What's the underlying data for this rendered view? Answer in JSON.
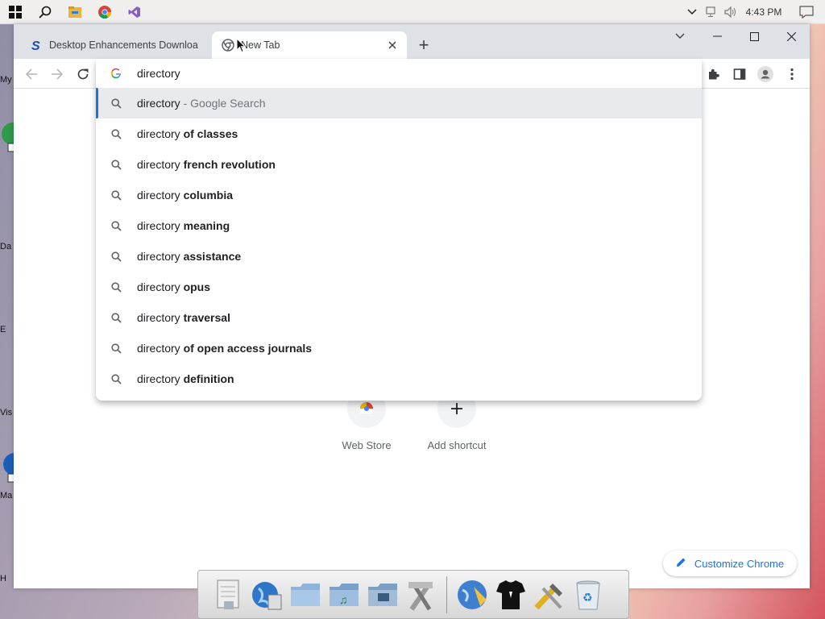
{
  "taskbar": {
    "clock": "4:43 PM",
    "icons": [
      "windows-start-icon",
      "search-icon",
      "file-explorer-icon",
      "chrome-icon",
      "visual-studio-icon"
    ]
  },
  "desktop_fragments": [
    "My",
    "Da",
    "E",
    "Vis",
    "Ma",
    "H"
  ],
  "browser": {
    "tabs": [
      {
        "title": "Desktop Enhancements Downloa",
        "favicon": "s-logo-icon",
        "active": false
      },
      {
        "title": "New Tab",
        "favicon": "chrome-icon",
        "active": true
      }
    ],
    "new_tab_symbol": "+",
    "omnibox": {
      "query": "directory",
      "suggestions": [
        {
          "prefix": "directory",
          "suffix": "",
          "hint": "Google Search",
          "selected": true
        },
        {
          "prefix": "directory",
          "suffix": "of classes",
          "hint": "",
          "selected": false
        },
        {
          "prefix": "directory",
          "suffix": "french revolution",
          "hint": "",
          "selected": false
        },
        {
          "prefix": "directory",
          "suffix": "columbia",
          "hint": "",
          "selected": false
        },
        {
          "prefix": "directory",
          "suffix": "meaning",
          "hint": "",
          "selected": false
        },
        {
          "prefix": "directory",
          "suffix": "assistance",
          "hint": "",
          "selected": false
        },
        {
          "prefix": "directory",
          "suffix": "opus",
          "hint": "",
          "selected": false
        },
        {
          "prefix": "directory",
          "suffix": "traversal",
          "hint": "",
          "selected": false
        },
        {
          "prefix": "directory",
          "suffix": "of open access journals",
          "hint": "",
          "selected": false
        },
        {
          "prefix": "directory",
          "suffix": "definition",
          "hint": "",
          "selected": false
        }
      ]
    },
    "shortcuts": [
      {
        "label": "Web Store",
        "icon": "chrome-web-store-icon"
      },
      {
        "label": "Add shortcut",
        "icon": "plus-icon"
      }
    ],
    "customize_label": "Customize Chrome"
  },
  "dock_items": [
    "preview-icon",
    "internet-globe-icon",
    "folder-icon",
    "music-folder-icon",
    "pictures-folder-icon",
    "utilities-icon",
    "network-globe-icon",
    "tshirt-icon",
    "tools-icon",
    "recycle-bin-icon"
  ],
  "colors": {
    "accent": "#1a73e8",
    "tabstrip": "#dee1e6",
    "selected_row": "#e8eaed"
  }
}
